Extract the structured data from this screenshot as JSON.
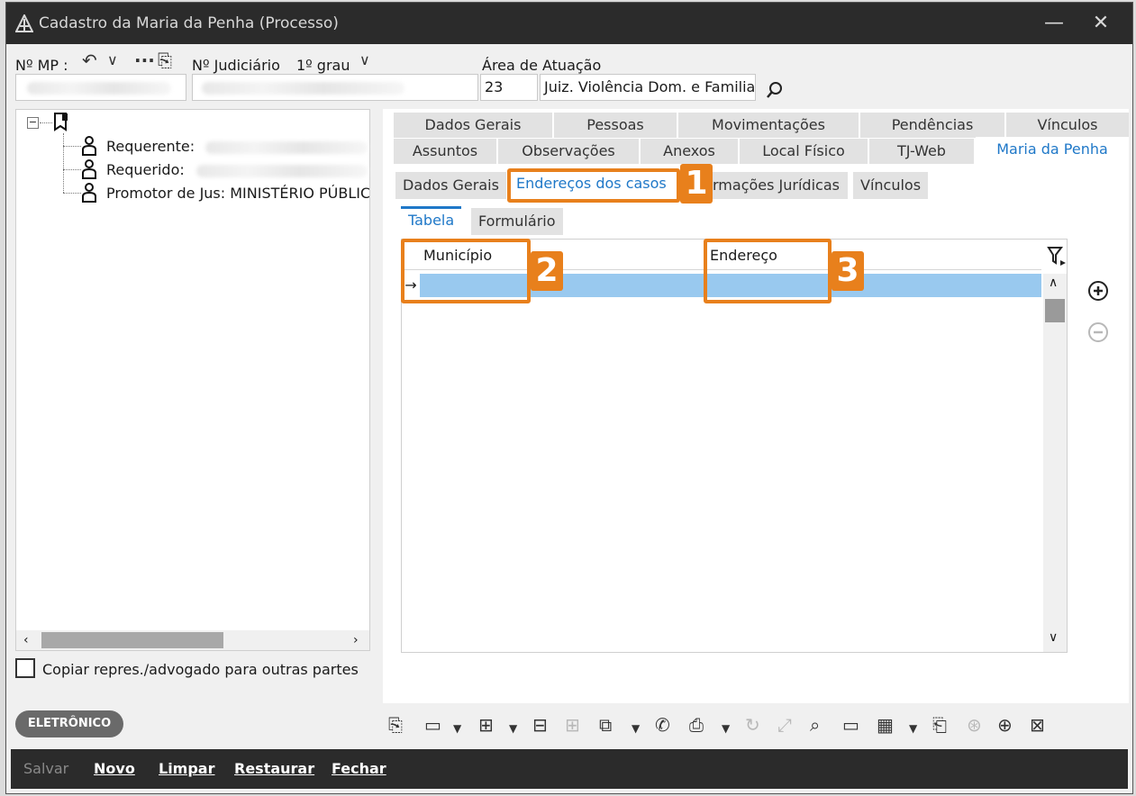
{
  "window": {
    "title": "Cadastro da Maria da Penha (Processo)",
    "minimize": "—",
    "close": "✕"
  },
  "header": {
    "mp_label": "Nº MP :",
    "judiciario_label": "Nº Judiciário",
    "grau": "1º grau",
    "area_label": "Área de Atuação",
    "area_code": "23",
    "area_name": "Juiz. Violência Dom. e Familia"
  },
  "tree": {
    "items": [
      {
        "label": "Requerente:"
      },
      {
        "label": "Requerido:"
      },
      {
        "label": "Promotor de Jus: MINISTÉRIO PÚBLIC"
      }
    ],
    "checkbox_label": "Copiar repres./advogado para outras partes"
  },
  "badge_eletronico": "ELETRÔNICO",
  "tabs_row1": [
    "Dados Gerais",
    "Pessoas",
    "Movimentações",
    "Pendências",
    "Vínculos"
  ],
  "tabs_row2": [
    "Assuntos",
    "Observações",
    "Anexos",
    "Local Físico",
    "TJ-Web",
    "Maria da Penha"
  ],
  "subtabs": [
    "Dados Gerais",
    "Endereços dos casos",
    "Informações Jurídicas",
    "Vínculos"
  ],
  "subtabs_visible_cut": "rmações Jurídicas",
  "view_tabs": [
    "Tabela",
    "Formulário"
  ],
  "grid": {
    "columns": [
      "Município",
      "Endereço"
    ]
  },
  "annotations": [
    "1",
    "2",
    "3"
  ],
  "bottom": {
    "salvar": "Salvar",
    "novo": "Novo",
    "limpar": "Limpar",
    "restaurar": "Restaurar",
    "fechar": "Fechar"
  },
  "colors": {
    "accent": "#1f78c8",
    "highlight": "#e8801c",
    "selected_row": "#99c9ef",
    "titlebar": "#2b2b2b"
  }
}
